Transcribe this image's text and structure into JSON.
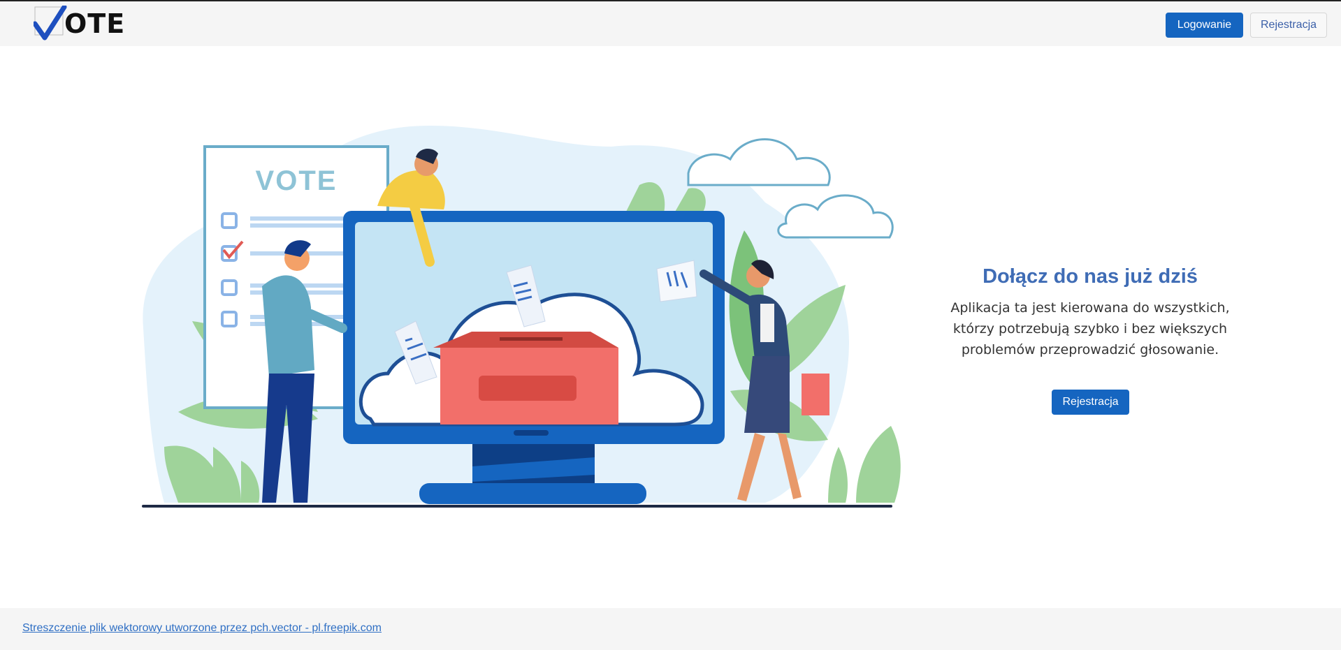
{
  "navbar": {
    "logo_text": "OTE",
    "login_label": "Logowanie",
    "register_label": "Rejestracja"
  },
  "illustration": {
    "poster_title": "VOTE"
  },
  "cta": {
    "heading": "Dołącz do nas już dziś",
    "line1": "Aplikacja ta jest kierowana do wszystkich,",
    "line2": "którzy potrzebują szybko i bez większych",
    "line3": "problemów przeprowadzić głosowanie.",
    "register_label": "Rejestracja"
  },
  "footer": {
    "credit_link": "Streszczenie plik wektorowy utworzone przez pch.vector - pl.freepik.com"
  },
  "colors": {
    "primary": "#1565c0",
    "heading": "#3f6cb5",
    "link": "#2f6fc4",
    "navbar_bg": "#f5f5f5"
  }
}
